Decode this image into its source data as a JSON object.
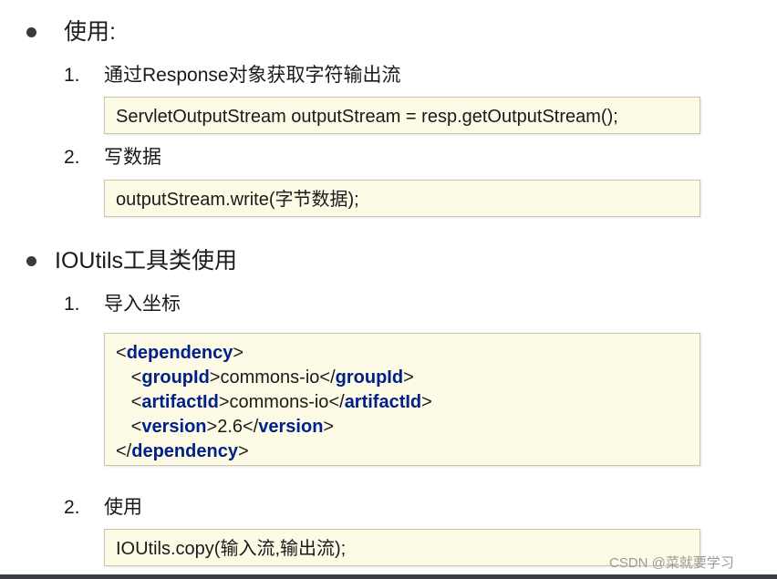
{
  "section1": {
    "heading": "使用:",
    "steps": [
      {
        "num": "1.",
        "label": "通过Response对象获取字符输出流",
        "code": "ServletOutputStream outputStream = resp.getOutputStream();"
      },
      {
        "num": "2.",
        "label": "写数据",
        "code": "outputStream.write(字节数据);"
      }
    ]
  },
  "section2": {
    "heading": "IOUtils工具类使用",
    "step1": {
      "num": "1.",
      "label": "导入坐标",
      "xml": {
        "lt": "<",
        "gt": ">",
        "lt_slash": "</",
        "indent": "   ",
        "dependency": "dependency",
        "groupId": "groupId",
        "groupId_value": "commons-io",
        "artifactId": "artifactId",
        "artifactId_value": "commons-io",
        "version": "version",
        "version_value": "2.6"
      }
    },
    "step2": {
      "num": "2.",
      "label": "使用",
      "code": "IOUtils.copy(输入流,输出流);"
    }
  },
  "watermark": "CSDN @菜就要学习"
}
